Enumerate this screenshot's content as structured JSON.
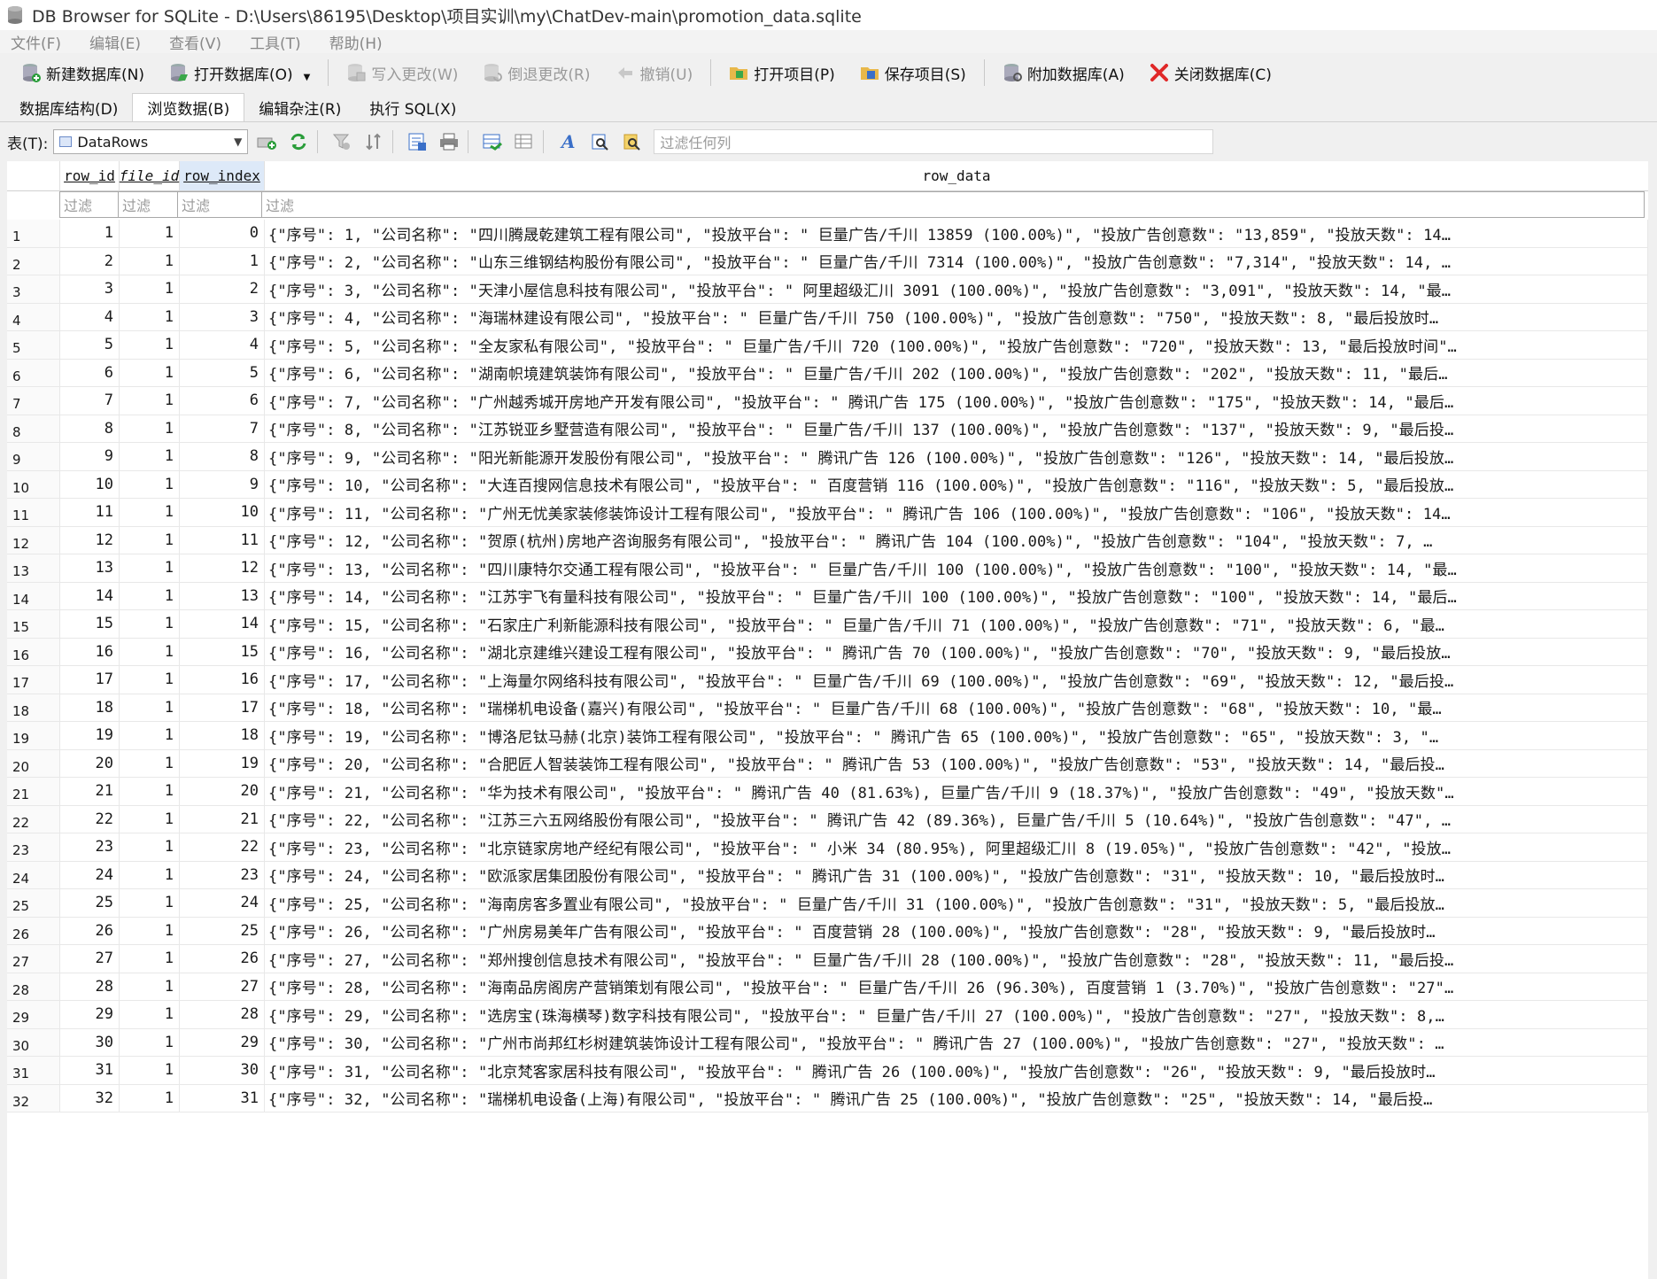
{
  "window": {
    "title": "DB Browser for SQLite - D:\\Users\\86195\\Desktop\\项目实训\\my\\ChatDev-main\\promotion_data.sqlite"
  },
  "menu": [
    "文件(F)",
    "编辑(E)",
    "查看(V)",
    "工具(T)",
    "帮助(H)"
  ],
  "toolbar": {
    "new_db": "新建数据库(N)",
    "open_db": "打开数据库(O)",
    "write_changes": "写入更改(W)",
    "revert_changes": "倒退更改(R)",
    "undo": "撤销(U)",
    "open_project": "打开项目(P)",
    "save_project": "保存项目(S)",
    "attach_db": "附加数据库(A)",
    "close_db": "关闭数据库(C)"
  },
  "tabs": [
    "数据库结构(D)",
    "浏览数据(B)",
    "编辑杂注(R)",
    "执行 SQL(X)"
  ],
  "filterbar": {
    "table_label": "表(T):",
    "table_value": "DataRows",
    "filter_all_placeholder": "过滤任何列"
  },
  "grid": {
    "columns": [
      "row_id",
      "file_id",
      "row_index",
      "row_data"
    ],
    "filter_placeholder": "过滤",
    "rows": [
      {
        "n": "1",
        "row_id": "1",
        "file_id": "1",
        "row_index": "0",
        "row_data": "{\"序号\": 1, \"公司名称\": \"四川腾晟乾建筑工程有限公司\", \"投放平台\": \" 巨量广告/千川 13859 (100.00%)\", \"投放广告创意数\": \"13,859\", \"投放天数\": 14…"
      },
      {
        "n": "2",
        "row_id": "2",
        "file_id": "1",
        "row_index": "1",
        "row_data": "{\"序号\": 2, \"公司名称\": \"山东三维钢结构股份有限公司\", \"投放平台\": \" 巨量广告/千川 7314 (100.00%)\", \"投放广告创意数\": \"7,314\", \"投放天数\": 14, …"
      },
      {
        "n": "3",
        "row_id": "3",
        "file_id": "1",
        "row_index": "2",
        "row_data": "{\"序号\": 3, \"公司名称\": \"天津小屋信息科技有限公司\", \"投放平台\": \" 阿里超级汇川 3091 (100.00%)\", \"投放广告创意数\": \"3,091\", \"投放天数\": 14, \"最…"
      },
      {
        "n": "4",
        "row_id": "4",
        "file_id": "1",
        "row_index": "3",
        "row_data": "{\"序号\": 4, \"公司名称\": \"海瑞林建设有限公司\", \"投放平台\": \" 巨量广告/千川 750 (100.00%)\", \"投放广告创意数\": \"750\", \"投放天数\": 8, \"最后投放时…"
      },
      {
        "n": "5",
        "row_id": "5",
        "file_id": "1",
        "row_index": "4",
        "row_data": "{\"序号\": 5, \"公司名称\": \"全友家私有限公司\", \"投放平台\": \" 巨量广告/千川 720 (100.00%)\", \"投放广告创意数\": \"720\", \"投放天数\": 13, \"最后投放时间\"…"
      },
      {
        "n": "6",
        "row_id": "6",
        "file_id": "1",
        "row_index": "5",
        "row_data": "{\"序号\": 6, \"公司名称\": \"湖南帜境建筑装饰有限公司\", \"投放平台\": \" 巨量广告/千川 202 (100.00%)\", \"投放广告创意数\": \"202\", \"投放天数\": 11, \"最后…"
      },
      {
        "n": "7",
        "row_id": "7",
        "file_id": "1",
        "row_index": "6",
        "row_data": "{\"序号\": 7, \"公司名称\": \"广州越秀城开房地产开发有限公司\", \"投放平台\": \" 腾讯广告 175 (100.00%)\", \"投放广告创意数\": \"175\", \"投放天数\": 14, \"最后…"
      },
      {
        "n": "8",
        "row_id": "8",
        "file_id": "1",
        "row_index": "7",
        "row_data": "{\"序号\": 8, \"公司名称\": \"江苏锐亚乡墅营造有限公司\", \"投放平台\": \" 巨量广告/千川 137 (100.00%)\", \"投放广告创意数\": \"137\", \"投放天数\": 9, \"最后投…"
      },
      {
        "n": "9",
        "row_id": "9",
        "file_id": "1",
        "row_index": "8",
        "row_data": "{\"序号\": 9, \"公司名称\": \"阳光新能源开发股份有限公司\", \"投放平台\": \" 腾讯广告 126 (100.00%)\", \"投放广告创意数\": \"126\", \"投放天数\": 14, \"最后投放…"
      },
      {
        "n": "10",
        "row_id": "10",
        "file_id": "1",
        "row_index": "9",
        "row_data": "{\"序号\": 10, \"公司名称\": \"大连百搜网信息技术有限公司\", \"投放平台\": \" 百度营销 116 (100.00%)\", \"投放广告创意数\": \"116\", \"投放天数\": 5, \"最后投放…"
      },
      {
        "n": "11",
        "row_id": "11",
        "file_id": "1",
        "row_index": "10",
        "row_data": "{\"序号\": 11, \"公司名称\": \"广州无忧美家装修装饰设计工程有限公司\", \"投放平台\": \" 腾讯广告 106 (100.00%)\", \"投放广告创意数\": \"106\", \"投放天数\": 14…"
      },
      {
        "n": "12",
        "row_id": "12",
        "file_id": "1",
        "row_index": "11",
        "row_data": "{\"序号\": 12, \"公司名称\": \"贺原(杭州)房地产咨询服务有限公司\", \"投放平台\": \" 腾讯广告 104 (100.00%)\", \"投放广告创意数\": \"104\", \"投放天数\": 7, …"
      },
      {
        "n": "13",
        "row_id": "13",
        "file_id": "1",
        "row_index": "12",
        "row_data": "{\"序号\": 13, \"公司名称\": \"四川康特尔交通工程有限公司\", \"投放平台\": \" 巨量广告/千川 100 (100.00%)\", \"投放广告创意数\": \"100\", \"投放天数\": 14, \"最…"
      },
      {
        "n": "14",
        "row_id": "14",
        "file_id": "1",
        "row_index": "13",
        "row_data": "{\"序号\": 14, \"公司名称\": \"江苏宇飞有量科技有限公司\", \"投放平台\": \" 巨量广告/千川 100 (100.00%)\", \"投放广告创意数\": \"100\", \"投放天数\": 14, \"最后…"
      },
      {
        "n": "15",
        "row_id": "15",
        "file_id": "1",
        "row_index": "14",
        "row_data": "{\"序号\": 15, \"公司名称\": \"石家庄广利新能源科技有限公司\", \"投放平台\": \" 巨量广告/千川 71 (100.00%)\", \"投放广告创意数\": \"71\", \"投放天数\": 6, \"最…"
      },
      {
        "n": "16",
        "row_id": "16",
        "file_id": "1",
        "row_index": "15",
        "row_data": "{\"序号\": 16, \"公司名称\": \"湖北京建维兴建设工程有限公司\", \"投放平台\": \" 腾讯广告 70 (100.00%)\", \"投放广告创意数\": \"70\", \"投放天数\": 9, \"最后投放…"
      },
      {
        "n": "17",
        "row_id": "17",
        "file_id": "1",
        "row_index": "16",
        "row_data": "{\"序号\": 17, \"公司名称\": \"上海量尔网络科技有限公司\", \"投放平台\": \" 巨量广告/千川 69 (100.00%)\", \"投放广告创意数\": \"69\", \"投放天数\": 12, \"最后投…"
      },
      {
        "n": "18",
        "row_id": "18",
        "file_id": "1",
        "row_index": "17",
        "row_data": "{\"序号\": 18, \"公司名称\": \"瑞梯机电设备(嘉兴)有限公司\", \"投放平台\": \" 巨量广告/千川 68 (100.00%)\", \"投放广告创意数\": \"68\", \"投放天数\": 10, \"最…"
      },
      {
        "n": "19",
        "row_id": "19",
        "file_id": "1",
        "row_index": "18",
        "row_data": "{\"序号\": 19, \"公司名称\": \"博洛尼钛马赫(北京)装饰工程有限公司\", \"投放平台\": \" 腾讯广告 65 (100.00%)\", \"投放广告创意数\": \"65\", \"投放天数\": 3, \"…"
      },
      {
        "n": "20",
        "row_id": "20",
        "file_id": "1",
        "row_index": "19",
        "row_data": "{\"序号\": 20, \"公司名称\": \"合肥匠人智装装饰工程有限公司\", \"投放平台\": \" 腾讯广告 53 (100.00%)\", \"投放广告创意数\": \"53\", \"投放天数\": 14, \"最后投…"
      },
      {
        "n": "21",
        "row_id": "21",
        "file_id": "1",
        "row_index": "20",
        "row_data": "{\"序号\": 21, \"公司名称\": \"华为技术有限公司\", \"投放平台\": \" 腾讯广告 40 (81.63%), 巨量广告/千川 9 (18.37%)\", \"投放广告创意数\": \"49\", \"投放天数\"…"
      },
      {
        "n": "22",
        "row_id": "22",
        "file_id": "1",
        "row_index": "21",
        "row_data": "{\"序号\": 22, \"公司名称\": \"江苏三六五网络股份有限公司\", \"投放平台\": \" 腾讯广告 42 (89.36%), 巨量广告/千川 5 (10.64%)\", \"投放广告创意数\": \"47\", …"
      },
      {
        "n": "23",
        "row_id": "23",
        "file_id": "1",
        "row_index": "22",
        "row_data": "{\"序号\": 23, \"公司名称\": \"北京链家房地产经纪有限公司\", \"投放平台\": \" 小米 34 (80.95%), 阿里超级汇川 8 (19.05%)\", \"投放广告创意数\": \"42\", \"投放…"
      },
      {
        "n": "24",
        "row_id": "24",
        "file_id": "1",
        "row_index": "23",
        "row_data": "{\"序号\": 24, \"公司名称\": \"欧派家居集团股份有限公司\", \"投放平台\": \" 腾讯广告 31 (100.00%)\", \"投放广告创意数\": \"31\", \"投放天数\": 10, \"最后投放时…"
      },
      {
        "n": "25",
        "row_id": "25",
        "file_id": "1",
        "row_index": "24",
        "row_data": "{\"序号\": 25, \"公司名称\": \"海南房客多置业有限公司\", \"投放平台\": \" 巨量广告/千川 31 (100.00%)\", \"投放广告创意数\": \"31\", \"投放天数\": 5, \"最后投放…"
      },
      {
        "n": "26",
        "row_id": "26",
        "file_id": "1",
        "row_index": "25",
        "row_data": "{\"序号\": 26, \"公司名称\": \"广州房易美年广告有限公司\", \"投放平台\": \" 百度营销 28 (100.00%)\", \"投放广告创意数\": \"28\", \"投放天数\": 9, \"最后投放时…"
      },
      {
        "n": "27",
        "row_id": "27",
        "file_id": "1",
        "row_index": "26",
        "row_data": "{\"序号\": 27, \"公司名称\": \"郑州搜创信息技术有限公司\", \"投放平台\": \" 巨量广告/千川 28 (100.00%)\", \"投放广告创意数\": \"28\", \"投放天数\": 11, \"最后投…"
      },
      {
        "n": "28",
        "row_id": "28",
        "file_id": "1",
        "row_index": "27",
        "row_data": "{\"序号\": 28, \"公司名称\": \"海南品房阁房产营销策划有限公司\", \"投放平台\": \" 巨量广告/千川 26 (96.30%), 百度营销 1 (3.70%)\", \"投放广告创意数\": \"27\"…"
      },
      {
        "n": "29",
        "row_id": "29",
        "file_id": "1",
        "row_index": "28",
        "row_data": "{\"序号\": 29, \"公司名称\": \"选房宝(珠海横琴)数字科技有限公司\", \"投放平台\": \" 巨量广告/千川 27 (100.00%)\", \"投放广告创意数\": \"27\", \"投放天数\": 8,…"
      },
      {
        "n": "30",
        "row_id": "30",
        "file_id": "1",
        "row_index": "29",
        "row_data": "{\"序号\": 30, \"公司名称\": \"广州市尚邦红杉树建筑装饰设计工程有限公司\", \"投放平台\": \" 腾讯广告 27 (100.00%)\", \"投放广告创意数\": \"27\", \"投放天数\": …"
      },
      {
        "n": "31",
        "row_id": "31",
        "file_id": "1",
        "row_index": "30",
        "row_data": "{\"序号\": 31, \"公司名称\": \"北京梵客家居科技有限公司\", \"投放平台\": \" 腾讯广告 26 (100.00%)\", \"投放广告创意数\": \"26\", \"投放天数\": 9, \"最后投放时…"
      },
      {
        "n": "32",
        "row_id": "32",
        "file_id": "1",
        "row_index": "31",
        "row_data": "{\"序号\": 32, \"公司名称\": \"瑞梯机电设备(上海)有限公司\", \"投放平台\": \" 腾讯广告 25 (100.00%)\", \"投放广告创意数\": \"25\", \"投放天数\": 14, \"最后投…"
      }
    ]
  }
}
